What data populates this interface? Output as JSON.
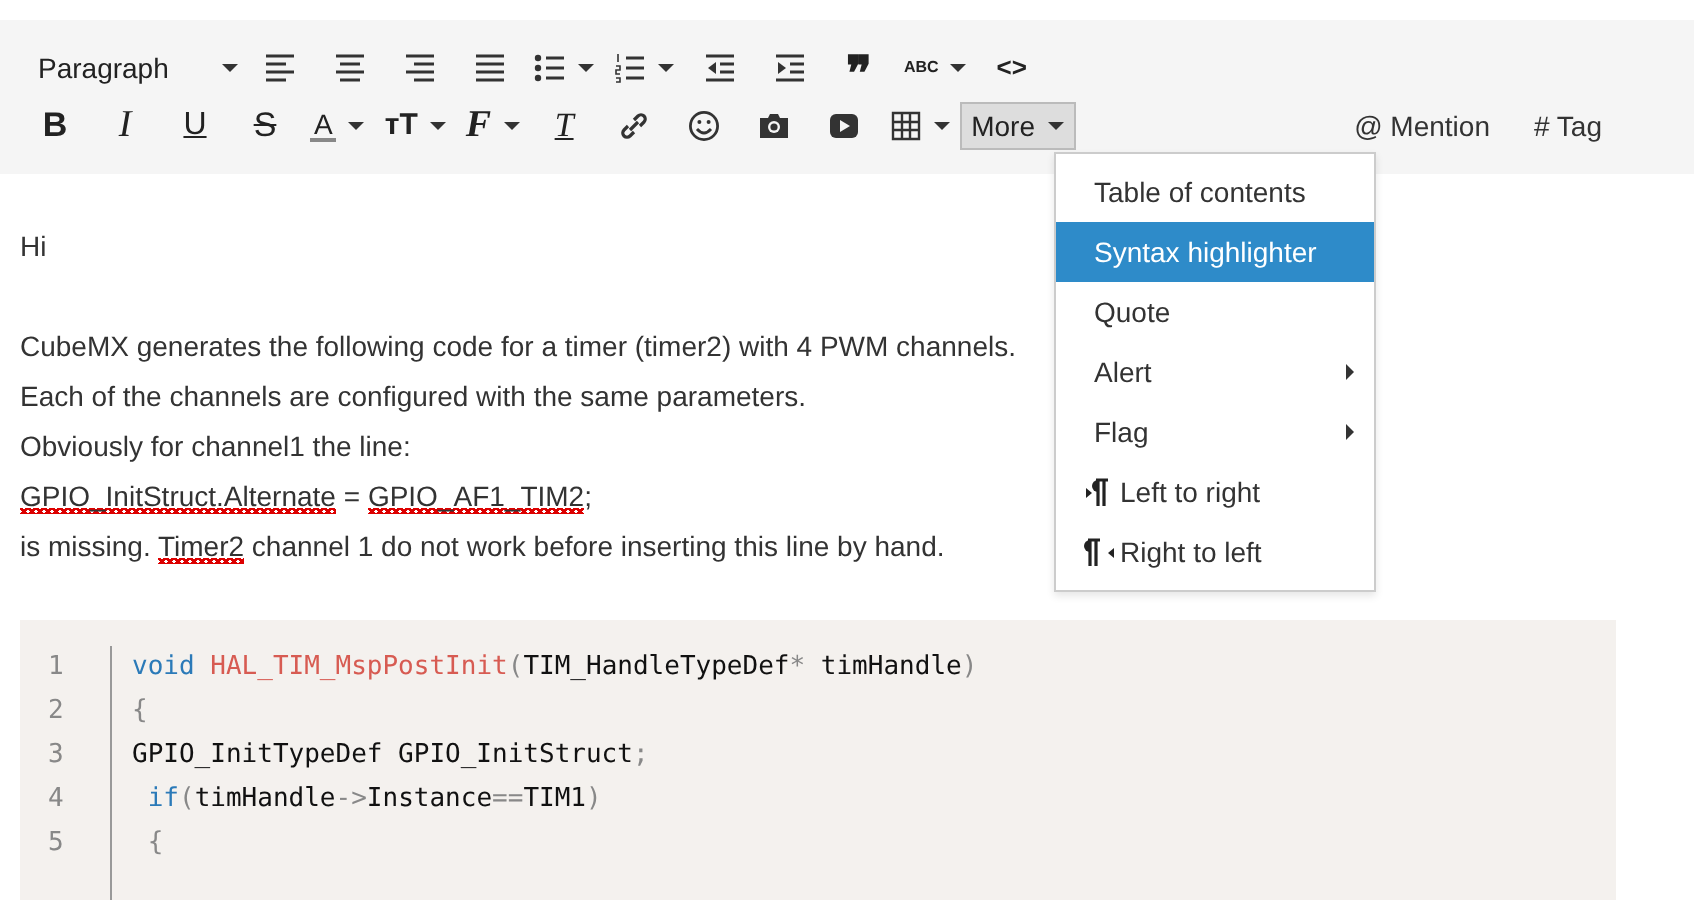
{
  "toolbar": {
    "rows": [
      [
        {
          "kind": "select",
          "glyph": "Paragraph",
          "caret": true
        },
        {
          "kind": "align-left"
        },
        {
          "kind": "align-center"
        },
        {
          "kind": "align-right"
        },
        {
          "kind": "justify"
        },
        {
          "kind": "bullets",
          "caret": true
        },
        {
          "kind": "numbers",
          "caret": true
        },
        {
          "kind": "outdent"
        },
        {
          "kind": "indent"
        },
        {
          "kind": "quote",
          "glyph": "❞"
        },
        {
          "kind": "spellcheck",
          "glyph": "ABC",
          "caret": true
        },
        {
          "kind": "code",
          "glyph": "<>"
        }
      ],
      [
        {
          "kind": "bold",
          "glyph": "B"
        },
        {
          "kind": "italic",
          "glyph": "I"
        },
        {
          "kind": "underline",
          "glyph": "U"
        },
        {
          "kind": "strike",
          "glyph": "S"
        },
        {
          "kind": "color",
          "glyph": "A",
          "caret": true
        },
        {
          "kind": "size",
          "glyph": "тT",
          "caret": true
        },
        {
          "kind": "font",
          "glyph": "F",
          "caret": true
        },
        {
          "kind": "clear",
          "glyph": "T"
        },
        {
          "kind": "link"
        },
        {
          "kind": "emoji"
        },
        {
          "kind": "camera"
        },
        {
          "kind": "video"
        },
        {
          "kind": "table",
          "caret": true
        },
        {
          "kind": "more",
          "glyph": "More",
          "caret": true,
          "selected": true
        },
        {
          "kind": "mention",
          "glyph": "@ Mention"
        },
        {
          "kind": "tag",
          "glyph": "# Tag"
        }
      ]
    ]
  },
  "menu": {
    "items": [
      {
        "label": "Table of contents",
        "kind": "plain",
        "selected": false
      },
      {
        "label": "Syntax highlighter",
        "kind": "plain",
        "selected": true
      },
      {
        "label": "Quote",
        "kind": "plain",
        "selected": false
      },
      {
        "label": "Alert",
        "kind": "submenu",
        "selected": false
      },
      {
        "label": "Flag",
        "kind": "submenu",
        "selected": false
      },
      {
        "label": "Left to right",
        "kind": "ltr",
        "selected": false
      },
      {
        "label": "Right to left",
        "kind": "rtl",
        "selected": false
      }
    ]
  },
  "body": {
    "paragraphs": [
      [
        {
          "text": "Hi",
          "misspelled": false
        }
      ],
      [
        {
          "text": "CubeMX generates the following code for a timer (timer2) with 4 PWM channels.",
          "misspelled": false
        }
      ],
      [
        {
          "text": "Each of the channels are configured with the same parameters.",
          "misspelled": false
        }
      ],
      [
        {
          "text": "Obviously for channel1 the line:",
          "misspelled": false
        }
      ],
      [
        {
          "text": "GPIO_InitStruct.Alternate",
          "misspelled": true
        },
        {
          "text": " = ",
          "misspelled": false
        },
        {
          "text": "GPIO_AF1_TIM2",
          "misspelled": true
        },
        {
          "text": ";",
          "misspelled": false
        }
      ],
      [
        {
          "text": "is missing. ",
          "misspelled": false
        },
        {
          "text": "Timer2",
          "misspelled": true
        },
        {
          "text": " channel 1 do not work before inserting this line by hand.",
          "misspelled": false
        }
      ]
    ]
  },
  "code": {
    "lines": [
      {
        "number": "1",
        "tokens": [
          {
            "kind": "kw",
            "text": "void "
          },
          {
            "kind": "fn",
            "text": "HAL_TIM_MspPostInit"
          },
          {
            "kind": "punct",
            "text": "("
          },
          {
            "kind": "plain",
            "text": "TIM_HandleTypeDef"
          },
          {
            "kind": "punct",
            "text": "*"
          },
          {
            "kind": "plain",
            "text": " timHandle"
          },
          {
            "kind": "punct",
            "text": ")"
          }
        ]
      },
      {
        "number": "2",
        "tokens": [
          {
            "kind": "punct",
            "text": "{"
          }
        ]
      },
      {
        "number": "3",
        "tokens": [
          {
            "kind": "plain",
            "text": "GPIO_InitTypeDef GPIO_InitStruct"
          },
          {
            "kind": "punct",
            "text": ";"
          }
        ]
      },
      {
        "number": "4",
        "tokens": [
          {
            "kind": "kw",
            "text": " if"
          },
          {
            "kind": "punct",
            "text": "("
          },
          {
            "kind": "plain",
            "text": "timHandle"
          },
          {
            "kind": "punct",
            "text": "->"
          },
          {
            "kind": "plain",
            "text": "Instance"
          },
          {
            "kind": "punct",
            "text": "=="
          },
          {
            "kind": "plain",
            "text": "TIM1"
          },
          {
            "kind": "punct",
            "text": ")"
          }
        ]
      },
      {
        "number": "5",
        "tokens": [
          {
            "kind": "punct",
            "text": " {"
          }
        ]
      }
    ]
  }
}
